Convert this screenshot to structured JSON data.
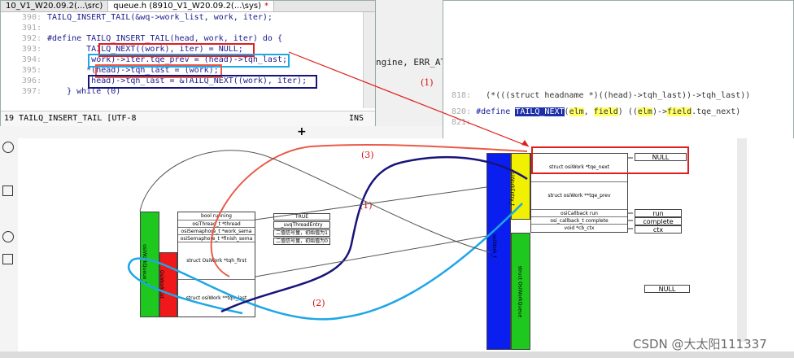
{
  "editor1": {
    "tabs": [
      "10_V1_W20.09.2(...\\src)",
      "queue.h (8910_V1_W20.09.2(...\\sys)"
    ],
    "active_tab_mark": "*",
    "lines": [
      {
        "no": "390:",
        "text": "TAILQ_INSERT_TAIL(&wq->work_list, work, iter);"
      },
      {
        "no": "391:",
        "text": ""
      },
      {
        "no": "392:",
        "text": "#define TAILQ_INSERT_TAIL(head, work, iter) do {"
      },
      {
        "no": "393:",
        "text": "        TAILQ_NEXT((work), iter) = NULL;"
      },
      {
        "no": "394:",
        "text": "        (work)->iter.tqe_prev = (head)->tqh_last;"
      },
      {
        "no": "395:",
        "text": "        *(head)->tqh_last = (work);"
      },
      {
        "no": "396:",
        "text": "        (head)->tqh_last = &TAILQ_NEXT((work), iter);"
      },
      {
        "no": "397:",
        "text": "    } while (0)"
      }
    ],
    "status_left": "19  TAILQ_INSERT_TAIL [UTF-8",
    "status_right": "INS"
  },
  "behind_text": "ngine, ERR_AT_",
  "annotations": [
    "(1)",
    "(1)",
    "(2)",
    "(3)"
  ],
  "editor2": {
    "line1_no": "818:",
    "line1_text": "   (*(((struct headname *)((head)->tqh_last))->tqh_last))",
    "line2_no": "820:",
    "line2_define": "#define",
    "line2_macro": "TAILQ_NEXT",
    "line2_elm": "elm",
    "line2_field": "field",
    "line2_rest": ".tqe_next)",
    "line3_no": "821:"
  },
  "diagram": {
    "wq_fields": [
      "bool running",
      "osiThread_t *thread",
      "osiSemaphore_t *work_sema",
      "osiSemaphore_t *finish_sema"
    ],
    "wq_values": [
      "TRUE",
      "_uvqThreadEntry",
      "二值信号量，初始值为1",
      "二值信号量，初始值为0"
    ],
    "wq_list_fields": [
      "struct OsiWork *tqh_first",
      "struct osiWork **tqh_last"
    ],
    "wq_green_label": "osiWorkQueue_t",
    "wq_red_label": "OsiWorkList",
    "work_fields": [
      "struct osiWork *tqe_next",
      "struct osiWork **tqe_prev",
      "osiCallback run",
      "osi_callback_t complete",
      "void *cb_ctx"
    ],
    "work_values": [
      "NULL",
      "run",
      "complete",
      "ctx",
      "NULL"
    ],
    "work_blue_label": "osiWork_t",
    "work_yellow_label": "osiWorkEntry_t",
    "work_green_label": "struct OsiWorkQueue"
  },
  "watermark": "CSDN @大太阳111337",
  "colors": {
    "red": "#e01e1e",
    "navy": "#17147a",
    "cyan": "#1ea6e6",
    "salmon": "#ea5a4a",
    "blue": "#0a1ef0",
    "green": "#1ec81e",
    "yellow": "#f0f000"
  }
}
